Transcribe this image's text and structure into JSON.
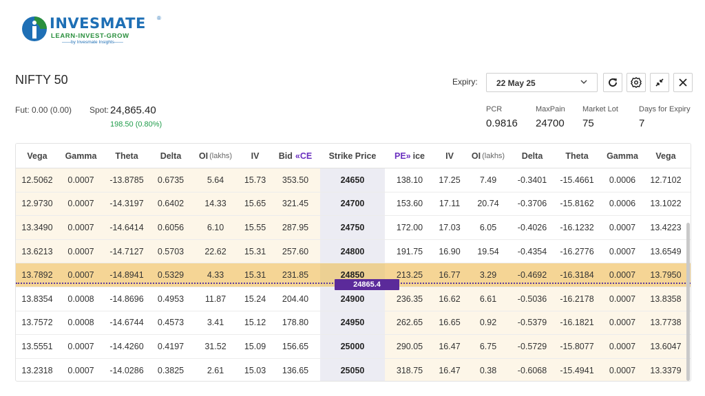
{
  "brand": {
    "name": "INVESMATE",
    "reg": "®",
    "tagline": "LEARN-INVEST-GROW",
    "byline": "——by Invesmate Insights——"
  },
  "header": {
    "index_name": "NIFTY 50",
    "expiry_label": "Expiry:",
    "expiry_value": "22 May 25"
  },
  "quote": {
    "fut_label": "Fut:",
    "fut_value": "0.00 (0.00)",
    "spot_label": "Spot:",
    "spot_value": "24,865.40",
    "spot_change": "198.50 (0.80%)"
  },
  "stats": [
    {
      "label": "PCR",
      "value": "0.9816"
    },
    {
      "label": "MaxPain",
      "value": "24700"
    },
    {
      "label": "Market Lot",
      "value": "75"
    },
    {
      "label": "Days for Expiry",
      "value": "7"
    }
  ],
  "table": {
    "headers": {
      "c_vega": "Vega",
      "c_gamma": "Gamma",
      "c_theta": "Theta",
      "c_delta": "Delta",
      "c_oi": "OI",
      "oi_unit": "(lakhs)",
      "c_iv": "IV",
      "c_bid": "Bid",
      "ce_tag": "«CE",
      "strike": "Strike Price",
      "pe_tag": "PE»",
      "p_price": "ice",
      "p_iv": "IV",
      "p_oi": "OI",
      "p_delta": "Delta",
      "p_theta": "Theta",
      "p_gamma": "Gamma",
      "p_vega": "Vega"
    },
    "spot_marker": "24865.4",
    "rows": [
      [
        "12.5062",
        "0.0007",
        "-13.8785",
        "0.6735",
        "5.64",
        "15.73",
        "353.50",
        "24650",
        "138.10",
        "17.25",
        "7.49",
        "-0.3401",
        "-15.4661",
        "0.0006",
        "12.7102"
      ],
      [
        "12.9730",
        "0.0007",
        "-14.3197",
        "0.6402",
        "14.33",
        "15.65",
        "321.45",
        "24700",
        "153.60",
        "17.11",
        "20.74",
        "-0.3706",
        "-15.8162",
        "0.0006",
        "13.1022"
      ],
      [
        "13.3490",
        "0.0007",
        "-14.6414",
        "0.6056",
        "6.10",
        "15.55",
        "287.95",
        "24750",
        "172.00",
        "17.03",
        "6.05",
        "-0.4026",
        "-16.1232",
        "0.0007",
        "13.4223"
      ],
      [
        "13.6213",
        "0.0007",
        "-14.7127",
        "0.5703",
        "22.62",
        "15.31",
        "257.60",
        "24800",
        "191.75",
        "16.90",
        "19.54",
        "-0.4354",
        "-16.2776",
        "0.0007",
        "13.6549"
      ],
      [
        "13.7892",
        "0.0007",
        "-14.8941",
        "0.5329",
        "4.33",
        "15.31",
        "231.85",
        "24850",
        "213.25",
        "16.77",
        "3.29",
        "-0.4692",
        "-16.3184",
        "0.0007",
        "13.7950"
      ],
      [
        "13.8354",
        "0.0008",
        "-14.8696",
        "0.4953",
        "11.87",
        "15.24",
        "204.40",
        "24900",
        "236.35",
        "16.62",
        "6.61",
        "-0.5036",
        "-16.2178",
        "0.0007",
        "13.8358"
      ],
      [
        "13.7572",
        "0.0008",
        "-14.6744",
        "0.4573",
        "3.41",
        "15.12",
        "178.80",
        "24950",
        "262.65",
        "16.65",
        "0.92",
        "-0.5379",
        "-16.1821",
        "0.0007",
        "13.7738"
      ],
      [
        "13.5551",
        "0.0007",
        "-14.4260",
        "0.4197",
        "31.52",
        "15.09",
        "156.65",
        "25000",
        "290.05",
        "16.47",
        "6.75",
        "-0.5729",
        "-15.8077",
        "0.0007",
        "13.6047"
      ],
      [
        "13.2318",
        "0.0007",
        "-14.0286",
        "0.3825",
        "2.61",
        "15.03",
        "136.65",
        "25050",
        "318.75",
        "16.47",
        "0.38",
        "-0.6068",
        "-15.4941",
        "0.0007",
        "13.3379"
      ]
    ],
    "highlight_row": 4
  },
  "colors": {
    "brand_blue": "#1e6fb5",
    "brand_green": "#2a8f3d",
    "accent_purple": "#5b2a9a",
    "highlight": "#f5d595",
    "itm_tint": "#fdf6e8",
    "positive": "#1f9c4a"
  },
  "icons": [
    "refresh-icon",
    "settings-icon",
    "collapse-icon",
    "close-icon",
    "chevron-down-icon"
  ]
}
